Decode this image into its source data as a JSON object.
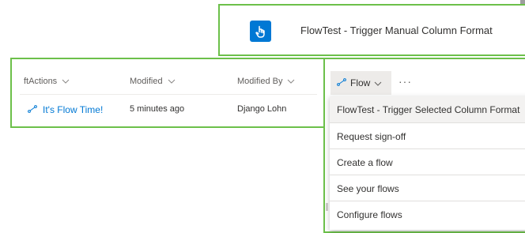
{
  "top_card": {
    "title": "FlowTest - Trigger Manual Column Format",
    "icon": "touch-hand-icon",
    "tile_color": "#0078d4"
  },
  "list": {
    "columns": [
      {
        "label": "ftActions"
      },
      {
        "label": "Modified"
      },
      {
        "label": "Modified By"
      }
    ],
    "rows": [
      {
        "action": "It's Flow Time!",
        "modified": "5 minutes ago",
        "modified_by": "Django Lohn"
      }
    ]
  },
  "command_bar": {
    "flow_label": "Flow",
    "more_label": "···"
  },
  "flow_menu": {
    "items": [
      {
        "label": "FlowTest - Trigger Selected Column Format"
      },
      {
        "label": "Request sign-off"
      },
      {
        "label": "Create a flow"
      },
      {
        "label": "See your flows"
      },
      {
        "label": "Configure flows"
      }
    ]
  },
  "colors": {
    "highlight_border": "#6cc04a",
    "link": "#0078d4"
  }
}
